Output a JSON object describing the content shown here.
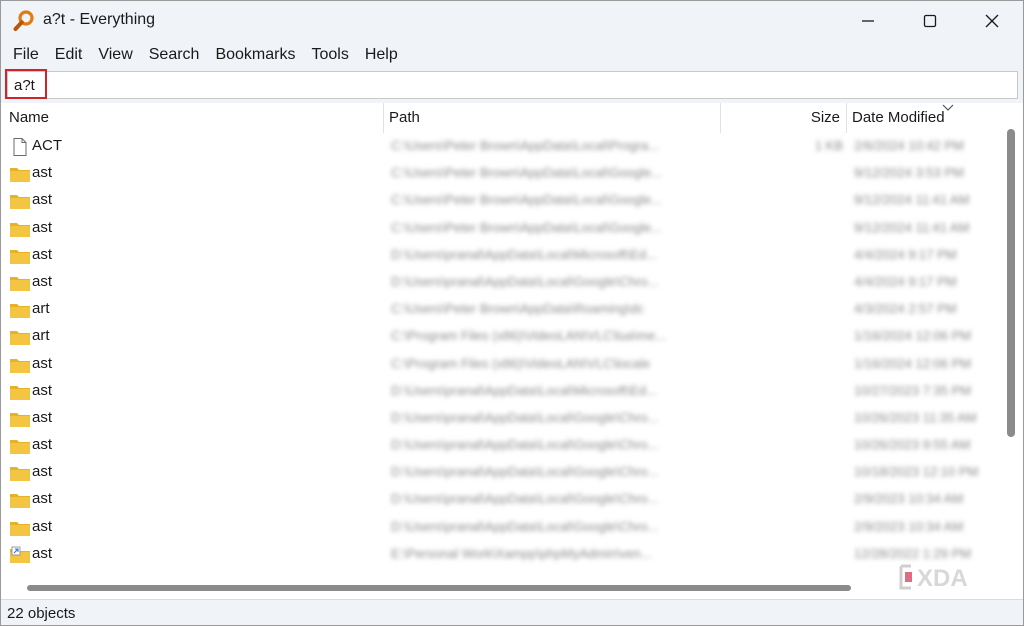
{
  "window": {
    "title": "a?t - Everything"
  },
  "menu": [
    "File",
    "Edit",
    "View",
    "Search",
    "Bookmarks",
    "Tools",
    "Help"
  ],
  "search": {
    "value": "a?t"
  },
  "columns": {
    "name": "Name",
    "path": "Path",
    "size": "Size",
    "date": "Date Modified"
  },
  "rows": [
    {
      "icon": "file-icon",
      "name": "ACT",
      "path": "C:\\Users\\Peter Brown\\AppData\\Local\\Progra...",
      "size": "1 KB",
      "date": "2/6/2024 10:42 PM"
    },
    {
      "icon": "folder-icon",
      "name": "ast",
      "path": "C:\\Users\\Peter Brown\\AppData\\Local\\Google...",
      "size": "",
      "date": "9/12/2024 3:53 PM"
    },
    {
      "icon": "folder-icon",
      "name": "ast",
      "path": "C:\\Users\\Peter Brown\\AppData\\Local\\Google...",
      "size": "",
      "date": "9/12/2024 11:41 AM"
    },
    {
      "icon": "folder-icon",
      "name": "ast",
      "path": "C:\\Users\\Peter Brown\\AppData\\Local\\Google...",
      "size": "",
      "date": "9/12/2024 11:41 AM"
    },
    {
      "icon": "folder-icon",
      "name": "ast",
      "path": "D:\\Users\\pranal\\AppData\\Local\\Microsoft\\Ed...",
      "size": "",
      "date": "4/4/2024 9:17 PM"
    },
    {
      "icon": "folder-icon",
      "name": "ast",
      "path": "D:\\Users\\pranal\\AppData\\Local\\Google\\Chro...",
      "size": "",
      "date": "4/4/2024 9:17 PM"
    },
    {
      "icon": "folder-icon",
      "name": "art",
      "path": "C:\\Users\\Peter Brown\\AppData\\Roaming\\dc",
      "size": "",
      "date": "4/3/2024 2:57 PM"
    },
    {
      "icon": "folder-icon",
      "name": "art",
      "path": "C:\\Program Files (x86)\\VideoLAN\\VLC\\lua\\me...",
      "size": "",
      "date": "1/16/2024 12:06 PM"
    },
    {
      "icon": "folder-icon",
      "name": "ast",
      "path": "C:\\Program Files (x86)\\VideoLAN\\VLC\\locale",
      "size": "",
      "date": "1/16/2024 12:06 PM"
    },
    {
      "icon": "folder-icon",
      "name": "ast",
      "path": "D:\\Users\\pranal\\AppData\\Local\\Microsoft\\Ed...",
      "size": "",
      "date": "10/27/2023 7:35 PM"
    },
    {
      "icon": "folder-icon",
      "name": "ast",
      "path": "D:\\Users\\pranal\\AppData\\Local\\Google\\Chro...",
      "size": "",
      "date": "10/26/2023 11:35 AM"
    },
    {
      "icon": "folder-icon",
      "name": "ast",
      "path": "D:\\Users\\pranal\\AppData\\Local\\Google\\Chro...",
      "size": "",
      "date": "10/26/2023 9:55 AM"
    },
    {
      "icon": "folder-icon",
      "name": "ast",
      "path": "D:\\Users\\pranal\\AppData\\Local\\Google\\Chro...",
      "size": "",
      "date": "10/18/2023 12:10 PM"
    },
    {
      "icon": "folder-icon",
      "name": "ast",
      "path": "D:\\Users\\pranal\\AppData\\Local\\Google\\Chro...",
      "size": "",
      "date": "2/9/2023 10:34 AM"
    },
    {
      "icon": "folder-icon",
      "name": "ast",
      "path": "D:\\Users\\pranal\\AppData\\Local\\Google\\Chro...",
      "size": "",
      "date": "2/9/2023 10:34 AM"
    },
    {
      "icon": "shortcut-folder-icon",
      "name": "ast",
      "path": "E:\\Personal Work\\Xampp\\phpMyAdmin\\ven...",
      "size": "",
      "date": "12/28/2022 1:29 PM"
    }
  ],
  "status": {
    "text": "22 objects"
  },
  "watermark": {
    "text": "XDA"
  },
  "colors": {
    "chrome": "#f0f4f9",
    "folder": "#f4c542",
    "highlight": "#d0242b",
    "app_icon": "#e07b12"
  }
}
